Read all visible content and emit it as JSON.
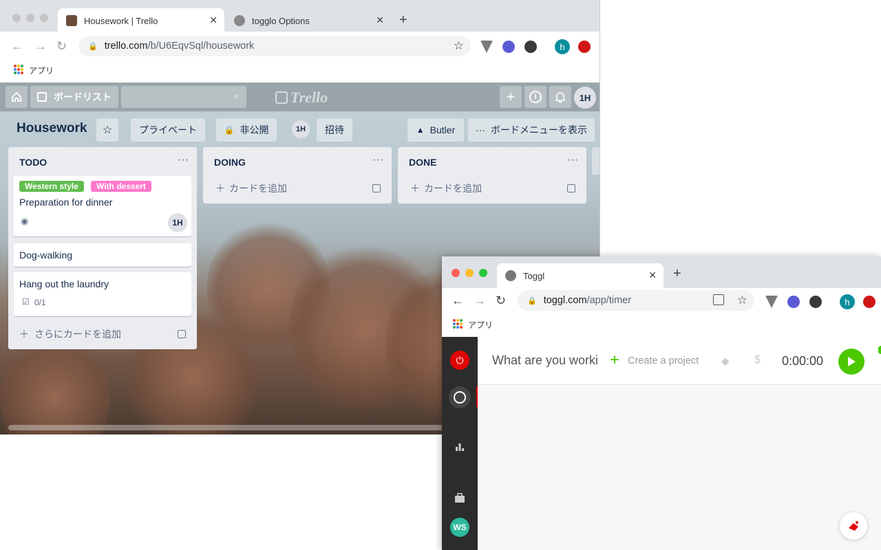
{
  "trello_browser": {
    "tabs": [
      {
        "title": "Housework | Trello",
        "active": true
      },
      {
        "title": "togglo Options",
        "active": false
      }
    ],
    "url_host": "trello.com",
    "url_path": "/b/U6EqvSql/housework",
    "bookmarks_apps": "アプリ",
    "header": {
      "boards_label": "ボードリスト",
      "logo": "Trello",
      "avatar": "1H"
    },
    "board": {
      "title": "Housework",
      "visibility_team": "プライベート",
      "visibility_private": "非公開",
      "member": "1H",
      "invite": "招待",
      "butler": "Butler",
      "show_menu": "ボードメニューを表示"
    },
    "lists": [
      {
        "title": "TODO",
        "cards": [
          {
            "labels": [
              {
                "text": "Western style",
                "color": "#61bd4f"
              },
              {
                "text": "With dessert",
                "color": "#ff78cb"
              }
            ],
            "title": "Preparation for dinner",
            "member": "1H"
          },
          {
            "title": "Dog-walking"
          },
          {
            "title": "Hang out the laundry",
            "checklist": "0/1"
          }
        ],
        "add_label": "さらにカードを追加"
      },
      {
        "title": "DOING",
        "add_label": "カードを追加"
      },
      {
        "title": "DONE",
        "add_label": "カードを追加"
      }
    ]
  },
  "toggl_browser": {
    "tab_title": "Toggl",
    "url_host": "toggl.com",
    "url_path": "/app/timer",
    "bookmarks_apps": "アプリ",
    "timer": {
      "description_placeholder": "What are you worki",
      "project_label": "Create a project",
      "time": "0:00:00"
    },
    "workspace": "WS"
  },
  "colors": {
    "toggl_green": "#4bc800",
    "toggl_red": "#e20505",
    "trello_text": "#172b4d"
  }
}
